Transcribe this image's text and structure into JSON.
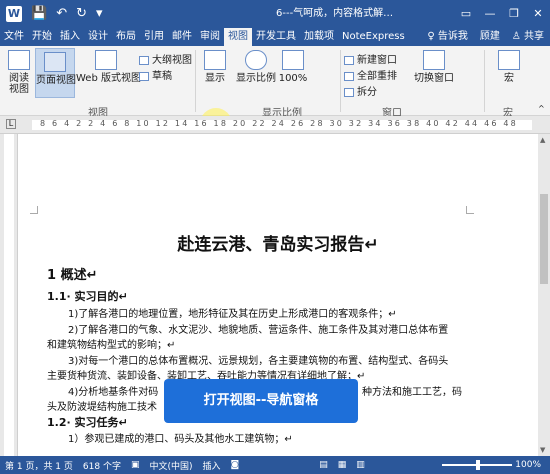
{
  "titlebar": {
    "word_icon": "W",
    "title": "6---气呵成，内容格式解…",
    "minimize": "—",
    "restore": "❐",
    "close": "✕"
  },
  "qat": {
    "save": "💾",
    "undo": "↶",
    "redo": "↻",
    "customize": "▾"
  },
  "tabs": [
    "文件",
    "开始",
    "插入",
    "设计",
    "布局",
    "引用",
    "邮件",
    "审阅",
    "视图",
    "开发工具",
    "加载项",
    "NoteExpress"
  ],
  "active_tab": "视图",
  "tab_right": {
    "tell_me": "♀ 告诉我",
    "user": "顾建",
    "share": "♙ 共享"
  },
  "ribbon": {
    "read_mode": "阅读\n视图",
    "print_layout": "页面视图",
    "web_layout": "Web 版式视图",
    "outline": "大纲视图",
    "draft": "草稿",
    "show": "显示",
    "zoom": "显示比例",
    "hundred": "100%",
    "new_window": "新建窗口",
    "arrange_all": "全部重排",
    "split": "拆分",
    "switch_windows": "切换窗口",
    "macros": "宏",
    "group_views": "视图",
    "group_zoom": "显示比例",
    "group_window": "窗口",
    "group_macros": "宏"
  },
  "ruler": {
    "numbers": "8 6 4 2  2 4 6 8 10 12 14 16 18 20 22 24 26 28 30 32 34 36 38 40 42 44 46 48"
  },
  "document": {
    "heading": "赴连云港、青岛实习报告↵",
    "section1": "1 概述↵",
    "section1_1": "1.1· 实习目的↵",
    "p1": "1)了解各港口的地理位置，地形特征及其在历史上形成港口的客观条件；↵",
    "p2a": "2)了解各港口的气象、水文泥沙、地貌地质、营运条件、施工条件及其对港口总体布置",
    "p2b": "和建筑物结构型式的影响；↵",
    "p3a": "3)对每一个港口的总体布置概况、远景规划，各主要建筑物的布置、结构型式、各码头",
    "p3b": "主要货种货流、装卸设备、装卸工艺、吞吐能力等情况有详细地了解；↵",
    "p4a": "4)分析地基条件对码",
    "p4a_tail": "种方法和施工工艺，码",
    "p4b": "头及防波堤结构施工技术",
    "section1_2": "1.2· 实习任务↵",
    "p5": "1）参观已建成的港口、码头及其他水工建筑物；↵"
  },
  "overlay": {
    "text": "打开视图--导航窗格"
  },
  "statusbar": {
    "page": "第 1 页，共 1 页",
    "words": "618 个字",
    "lang": "中文(中国)",
    "insert": "插入",
    "zoom": "100%"
  }
}
